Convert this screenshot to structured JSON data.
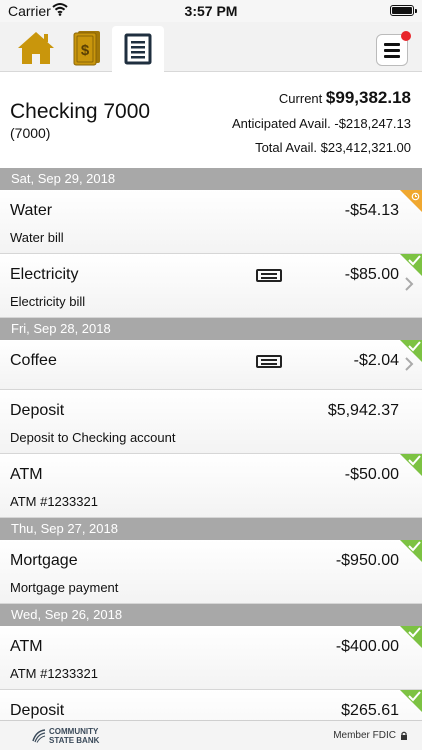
{
  "status_bar": {
    "carrier": "Carrier",
    "time": "3:57 PM"
  },
  "nav": {
    "icons": [
      "home-icon",
      "money-icon",
      "ledger-icon",
      "menu-icon"
    ],
    "menu_notification_color": "#e8242a",
    "icon_gold": "#c9960c"
  },
  "account": {
    "name": "Checking 7000",
    "number": "(7000)",
    "current_label": "Current",
    "current_value": "$99,382.18",
    "anticipated_label": "Anticipated Avail.",
    "anticipated_value": "-$218,247.13",
    "total_label": "Total Avail.",
    "total_value": "$23,412,321.00"
  },
  "groups": [
    {
      "date": "Sat, Sep 29, 2018",
      "transactions": [
        {
          "title": "Water",
          "desc": "Water bill",
          "amount": "-$54.13",
          "status": "pending",
          "memo": false,
          "chevron": false
        },
        {
          "title": "Electricity",
          "desc": "Electricity bill",
          "amount": "-$85.00",
          "status": "cleared",
          "memo": true,
          "chevron": true
        }
      ]
    },
    {
      "date": "Fri, Sep 28, 2018",
      "transactions": [
        {
          "title": "Coffee",
          "desc": "",
          "amount": "-$2.04",
          "status": "cleared",
          "memo": true,
          "chevron": true
        },
        {
          "title": "Deposit",
          "desc": "Deposit to Checking account",
          "amount": "$5,942.37",
          "status": "none",
          "memo": false,
          "chevron": false
        },
        {
          "title": "ATM",
          "desc": "ATM #1233321",
          "amount": "-$50.00",
          "status": "cleared",
          "memo": false,
          "chevron": false
        }
      ]
    },
    {
      "date": "Thu, Sep 27, 2018",
      "transactions": [
        {
          "title": "Mortgage",
          "desc": "Mortgage payment",
          "amount": "-$950.00",
          "status": "cleared",
          "memo": false,
          "chevron": false
        }
      ]
    },
    {
      "date": "Wed, Sep 26, 2018",
      "transactions": [
        {
          "title": "ATM",
          "desc": "ATM #1233321",
          "amount": "-$400.00",
          "status": "cleared",
          "memo": false,
          "chevron": false
        },
        {
          "title": "Deposit",
          "desc": "",
          "amount": "$265.61",
          "status": "cleared",
          "memo": false,
          "chevron": false
        }
      ]
    }
  ],
  "colors": {
    "cleared": "#7cc242",
    "pending": "#f0a830",
    "date_header": "#a8a8a8"
  },
  "footer": {
    "bank_line1": "COMMUNITY",
    "bank_line2": "STATE BANK",
    "fdic": "Member FDIC"
  }
}
